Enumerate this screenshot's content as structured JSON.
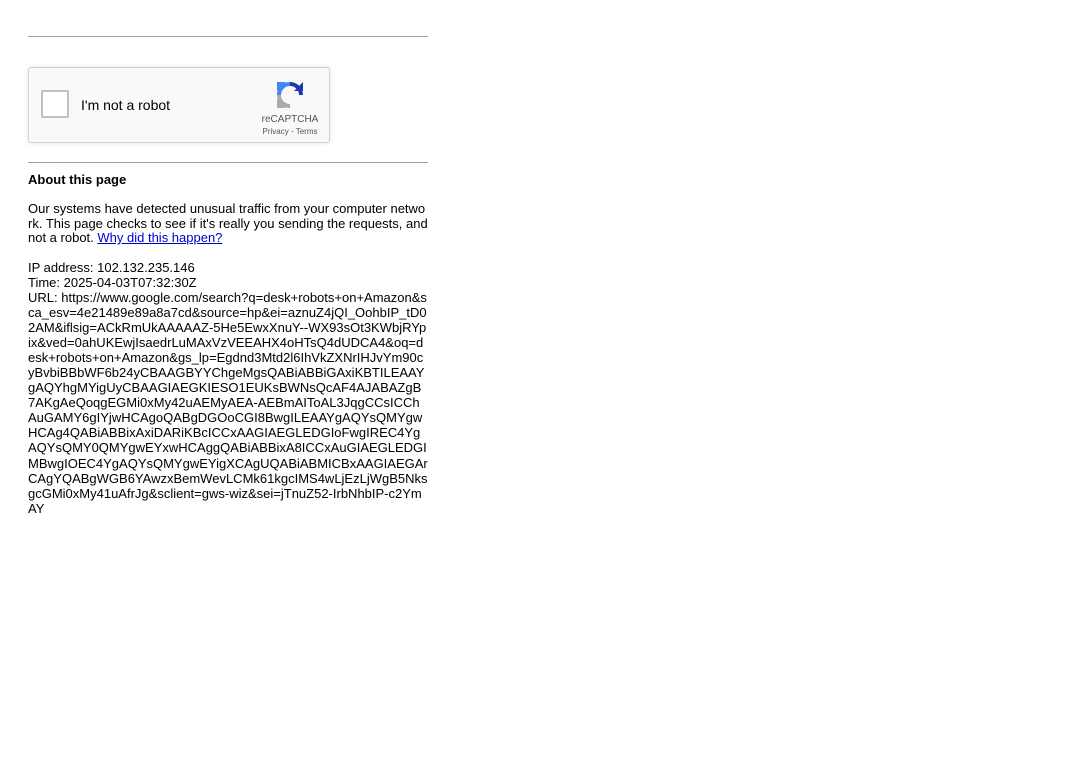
{
  "recaptcha": {
    "checkbox_label": "I'm not a robot",
    "brand": "reCAPTCHA",
    "privacy_link": "Privacy",
    "separator": " - ",
    "terms_link": "Terms",
    "logo_icon": "recaptcha-logo-icon"
  },
  "about": {
    "title": "About this page",
    "description": "Our systems have detected unusual traffic from your computer network. This page checks to see if it's really you sending the requests, and not a robot. ",
    "why_link": "Why did this happen?",
    "link_color": "#0000cc"
  },
  "details": {
    "ip_label": "IP address: ",
    "ip_value": "102.132.235.146",
    "time_label": "Time: ",
    "time_value": "2025-04-03T07:32:30Z",
    "url_label": "URL: ",
    "url_value": "https://www.google.com/search?q=desk+robots+on+Amazon&sca_esv=4e21489e89a8a7cd&source=hp&ei=aznuZ4jQI_OohbIP_tD02AM&iflsig=ACkRmUkAAAAAZ-5He5EwxXnuY--WX93sOt3KWbjRYpix&ved=0ahUKEwjIsaedrLuMAxVzVEEAHX4oHTsQ4dUDCA4&oq=desk+robots+on+Amazon&gs_lp=Egdnd3Mtd2l6IhVkZXNrIHJvYm90cyBvbiBBbWF6b24yCBAAGBYYChgeMgsQABiABBiGAxiKBTILEAAYgAQYhgMYigUyCBAAGIAEGKIESO1EUKsBWNsQcAF4AJABAZgB7AKgAeQoqgEGMi0xMy42uAEMyAEA-AEBmAIToAL3JqgCCsICChAuGAMY6gIYjwHCAgoQABgDGOoCGI8BwgILEAAYgAQYsQMYgwHCAg4QABiABBixAxiDARiKBcICCxAAGIAEGLEDGIoFwgIREC4YgAQYsQMY0QMYgwEYxwHCAggQABiABBixA8ICCxAuGIAEGLEDGIMBwgIOEC4YgAQYsQMYgwEYigXCAgUQABiABMICBxAAGIAEGArCAgYQABgWGB6YAwzxBemWevLCMk61kgcIMS4wLjEzLjWgB5NksgcGMi0xMy41uAfrJg&sclient=gws-wiz&sei=jTnuZ52-IrbNhbIP-c2YmAY"
  },
  "colors": {
    "rule": "#a0a0a0",
    "recaptcha_bg": "#f9f9f9",
    "recaptcha_border": "#d3d3d3"
  }
}
